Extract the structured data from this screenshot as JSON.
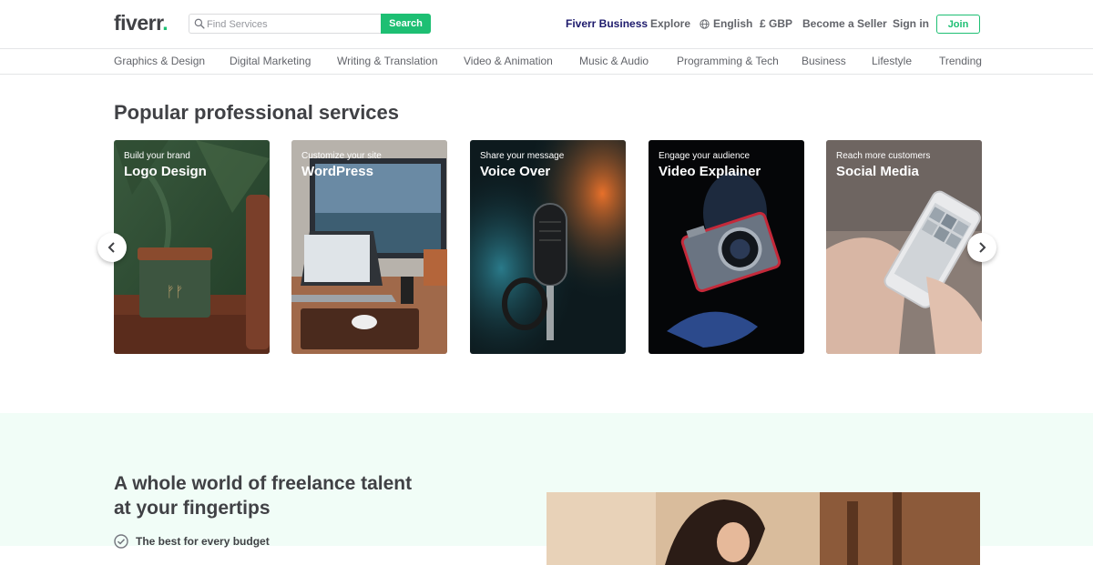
{
  "header": {
    "logo_text": "fiverr",
    "logo_dot": ".",
    "search_placeholder": "Find Services",
    "search_button": "Search",
    "fiverr_business": "Fiverr Business",
    "explore": "Explore",
    "language": "English",
    "currency": "£ GBP",
    "become_seller": "Become a Seller",
    "sign_in": "Sign in",
    "join": "Join"
  },
  "categories": [
    "Graphics & Design",
    "Digital Marketing",
    "Writing & Translation",
    "Video & Animation",
    "Music & Audio",
    "Programming & Tech",
    "Business",
    "Lifestyle",
    "Trending"
  ],
  "popular": {
    "title": "Popular professional services",
    "cards": [
      {
        "subtitle": "Build your brand",
        "title": "Logo Design"
      },
      {
        "subtitle": "Customize your site",
        "title": "WordPress"
      },
      {
        "subtitle": "Share your message",
        "title": "Voice Over"
      },
      {
        "subtitle": "Engage your audience",
        "title": "Video Explainer"
      },
      {
        "subtitle": "Reach more customers",
        "title": "Social Media"
      }
    ]
  },
  "freelance": {
    "title": "A whole world of freelance talent at your fingertips",
    "item_1": "The best for every budget"
  },
  "colors": {
    "brand_green": "#1dbf73",
    "business_navy": "#1d1a6c",
    "section_bg": "#f1fdf7"
  }
}
